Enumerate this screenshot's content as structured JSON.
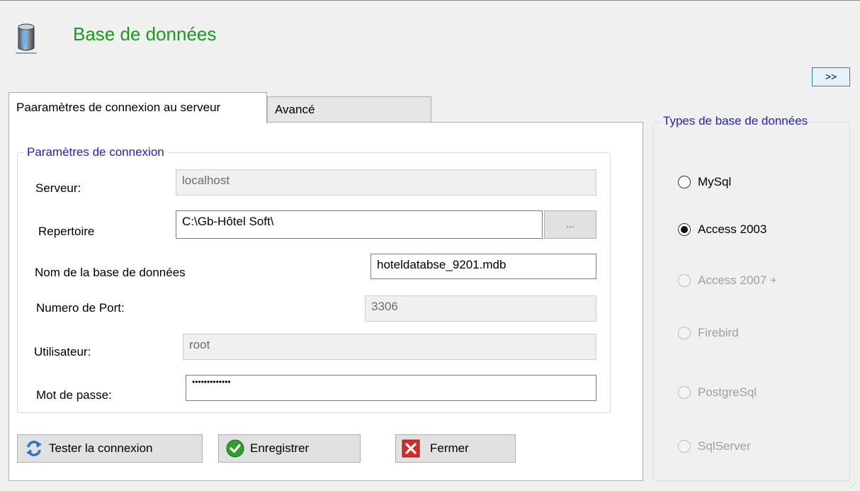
{
  "window": {
    "title": "Base de données",
    "expand_label": ">>"
  },
  "tabs": [
    {
      "label": "Paaramètres de connexion au serveur",
      "active": true
    },
    {
      "label": "Avancé",
      "active": false
    }
  ],
  "connection": {
    "legend": "Paramètres de connexion",
    "server_label": "Serveur:",
    "server_value": "localhost",
    "directory_label": "Repertoire",
    "directory_value": "C:\\Gb-Hôtel Soft\\",
    "browse_label": "...",
    "dbname_label": "Nom de la base de données",
    "dbname_value": "hoteldatabse_9201.mdb",
    "port_label": "Numero de Port:",
    "port_value": "3306",
    "user_label": "Utilisateur:",
    "user_value": "root",
    "password_label": "Mot de passe:",
    "password_value": "•••••••••••••"
  },
  "buttons": {
    "test": "Tester la connexion",
    "save": "Enregistrer",
    "close": "Fermer"
  },
  "db_types": {
    "legend": "Types de base de données",
    "options": [
      {
        "label": "MySql",
        "selected": false,
        "enabled": true
      },
      {
        "label": "Access 2003",
        "selected": true,
        "enabled": true
      },
      {
        "label": "Access 2007 +",
        "selected": false,
        "enabled": false
      },
      {
        "label": "Firebird",
        "selected": false,
        "enabled": false
      },
      {
        "label": "PostgreSql",
        "selected": false,
        "enabled": false
      },
      {
        "label": "SqlServer",
        "selected": false,
        "enabled": false
      }
    ]
  },
  "colors": {
    "title": "#1a9a1a",
    "legend": "#2020d0",
    "accent_border": "#3c7fb1"
  }
}
